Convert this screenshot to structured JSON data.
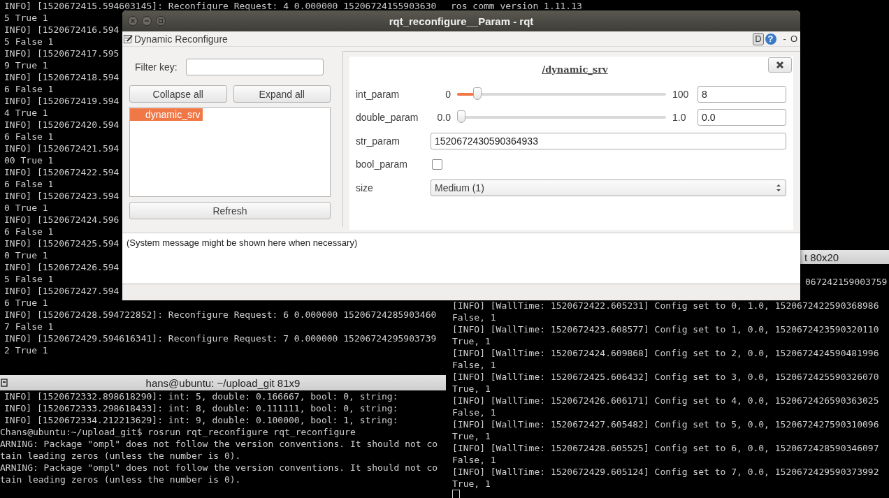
{
  "terminal_top_left": {
    "lines": [
      "INFO] [1520672415.594603145]: Reconfigure Request: 4 0.000000 15206724155903630",
      "5 True 1",
      "INFO] [1520672416.594",
      "5 False 1",
      "INFO] [1520672417.595",
      "9 True 1",
      "INFO] [1520672418.594",
      "6 False 1",
      "INFO] [1520672419.594",
      "4 True 1",
      "INFO] [1520672420.594",
      "6 False 1",
      "INFO] [1520672421.594",
      "00 True 1",
      "INFO] [1520672422.594",
      "6 False 1",
      "INFO] [1520672423.594",
      "0 True 1",
      "INFO] [1520672424.596",
      "6 False 1",
      "INFO] [1520672425.594",
      "0 True 1",
      "INFO] [1520672426.594",
      "5 False 1",
      "INFO] [1520672427.594",
      "6 True 1",
      "INFO] [1520672428.594722852]: Reconfigure Request: 6 0.000000 15206724285903460",
      "7 False 1",
      "INFO] [1520672429.594616341]: Reconfigure Request: 7 0.000000 15206724295903739",
      "2 True 1"
    ]
  },
  "terminal_top_right": {
    "lines": [
      "ros comm version 1.11.13"
    ]
  },
  "terminal_right": {
    "title": "t 80x20",
    "partial_line": "067242159003759",
    "lines": [
      "[INFO] [WallTime: 1520672422.605231] Config set to 0, 1.0, 1520672422590368986",
      "False, 1",
      "[INFO] [WallTime: 1520672423.608577] Config set to 1, 0.0, 1520672423590320110",
      "True, 1",
      "[INFO] [WallTime: 1520672424.609868] Config set to 2, 0.0, 1520672424590481996",
      "False, 1",
      "[INFO] [WallTime: 1520672425.606432] Config set to 3, 0.0, 1520672425590326070",
      "True, 1",
      "[INFO] [WallTime: 1520672426.606171] Config set to 4, 0.0, 1520672426590363025",
      "False, 1",
      "[INFO] [WallTime: 1520672427.605482] Config set to 5, 0.0, 1520672427590310096",
      "True, 1",
      "[INFO] [WallTime: 1520672428.605525] Config set to 6, 0.0, 1520672428590346097",
      "False, 1",
      "[INFO] [WallTime: 1520672429.605124] Config set to 7, 0.0, 1520672429590373992",
      "True, 1"
    ]
  },
  "terminal_bottom_left": {
    "title": "hans@ubuntu: ~/upload_git 81x9",
    "lines": [
      "INFO] [1520672332.898618290]: int: 5, double: 0.166667, bool: 0, string:",
      "INFO] [1520672333.298618433]: int: 8, double: 0.111111, bool: 0, string:",
      "INFO] [1520672334.212213629]: int: 9, double: 0.100000, bool: 1, string:",
      "Chans@ubuntu:~/upload_git$ rosrun rqt_reconfigure rqt_reconfigure",
      "ARNING: Package \"ompl\" does not follow the version conventions. It should not co",
      "tain leading zeros (unless the number is 0).",
      "ARNING: Package \"ompl\" does not follow the version conventions. It should not co",
      "tain leading zeros (unless the number is 0)."
    ]
  },
  "rqt_window": {
    "title": "rqt_reconfigure__Param - rqt",
    "plugin_title": "Dynamic Reconfigure",
    "dock_buttons": [
      "D",
      "?",
      "-",
      "O"
    ],
    "filter": {
      "label": "Filter key:"
    },
    "tree_buttons": [
      "Collapse all",
      "Expand all"
    ],
    "tree": [
      {
        "label": "dynamic_srv",
        "selected": true
      }
    ],
    "refresh": "Refresh",
    "panel": {
      "title": "/dynamic_srv",
      "params": [
        {
          "kind": "slider",
          "label": "int_param",
          "min": "0",
          "max": "100",
          "level": 0.08,
          "value": "8"
        },
        {
          "kind": "slider",
          "label": "double_param",
          "min": "0.0",
          "max": "1.0",
          "level": 0,
          "value": "0.0"
        },
        {
          "kind": "text",
          "label": "str_param",
          "value": "1520672430590364933"
        },
        {
          "kind": "checkbox",
          "label": "bool_param",
          "checked": false
        },
        {
          "kind": "combo",
          "label": "size",
          "value": "Medium (1)"
        }
      ]
    },
    "message": "(System message might be shown here when necessary)"
  }
}
